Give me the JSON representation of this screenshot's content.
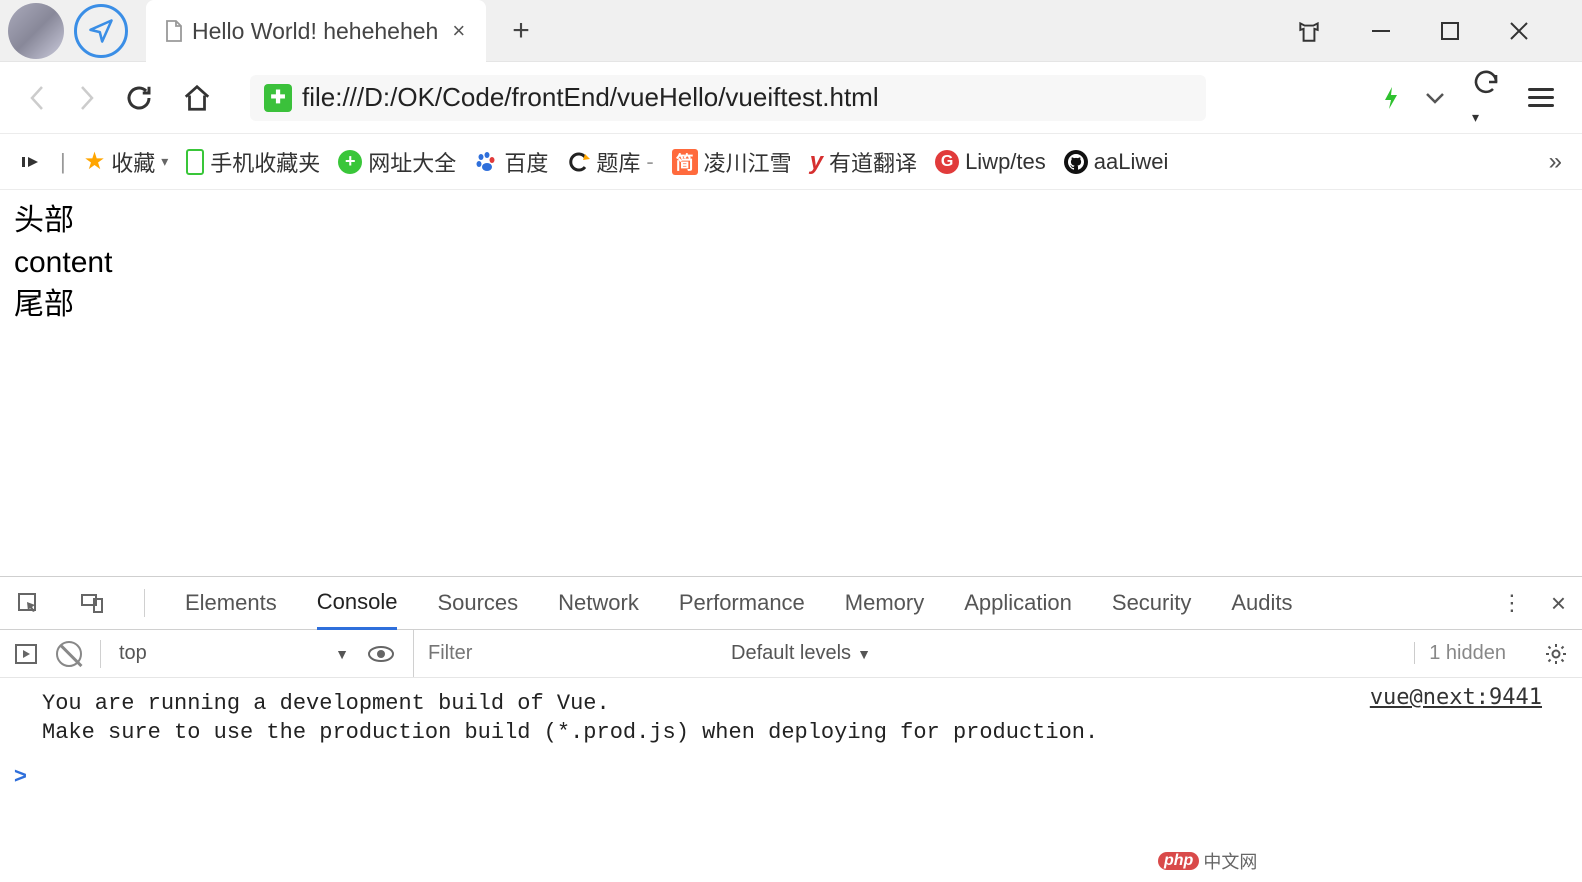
{
  "titlebar": {
    "tab_title": "Hello World! heheheheh",
    "close_glyph": "×",
    "newtab_glyph": "+"
  },
  "addressbar": {
    "url": "file:///D:/OK/Code/frontEnd/vueHello/vueiftest.html"
  },
  "bookmarks": {
    "favorites_label": "收藏",
    "items": [
      {
        "icon": "phone",
        "label": "手机收藏夹"
      },
      {
        "icon": "360",
        "label": "网址大全"
      },
      {
        "icon": "baidu",
        "label": "百度"
      },
      {
        "icon": "c",
        "label": "题库",
        "suffix": "-"
      },
      {
        "icon": "jian",
        "label": "凌川江雪"
      },
      {
        "icon": "y",
        "label": "有道翻译"
      },
      {
        "icon": "g",
        "label": "Liwp/tes"
      },
      {
        "icon": "gh",
        "label": "aaLiwei"
      }
    ],
    "more_glyph": "»"
  },
  "page": {
    "line1": "头部",
    "line2": "content",
    "line3": "尾部"
  },
  "devtools": {
    "tabs": [
      "Elements",
      "Console",
      "Sources",
      "Network",
      "Performance",
      "Memory",
      "Application",
      "Security",
      "Audits"
    ],
    "active_tab": "Console",
    "more_glyph": "⋮",
    "close_glyph": "×",
    "toolbar": {
      "context": "top",
      "context_caret": "▼",
      "filter_placeholder": "Filter",
      "levels_label": "Default levels",
      "levels_caret": "▼",
      "hidden_label": "1 hidden"
    },
    "console_message": "You are running a development build of Vue.\nMake sure to use the production build (*.prod.js) when deploying for production.",
    "console_link": "vue@next:9441",
    "prompt_glyph": ">"
  },
  "watermark": {
    "pill": "php",
    "text": "中文网"
  }
}
